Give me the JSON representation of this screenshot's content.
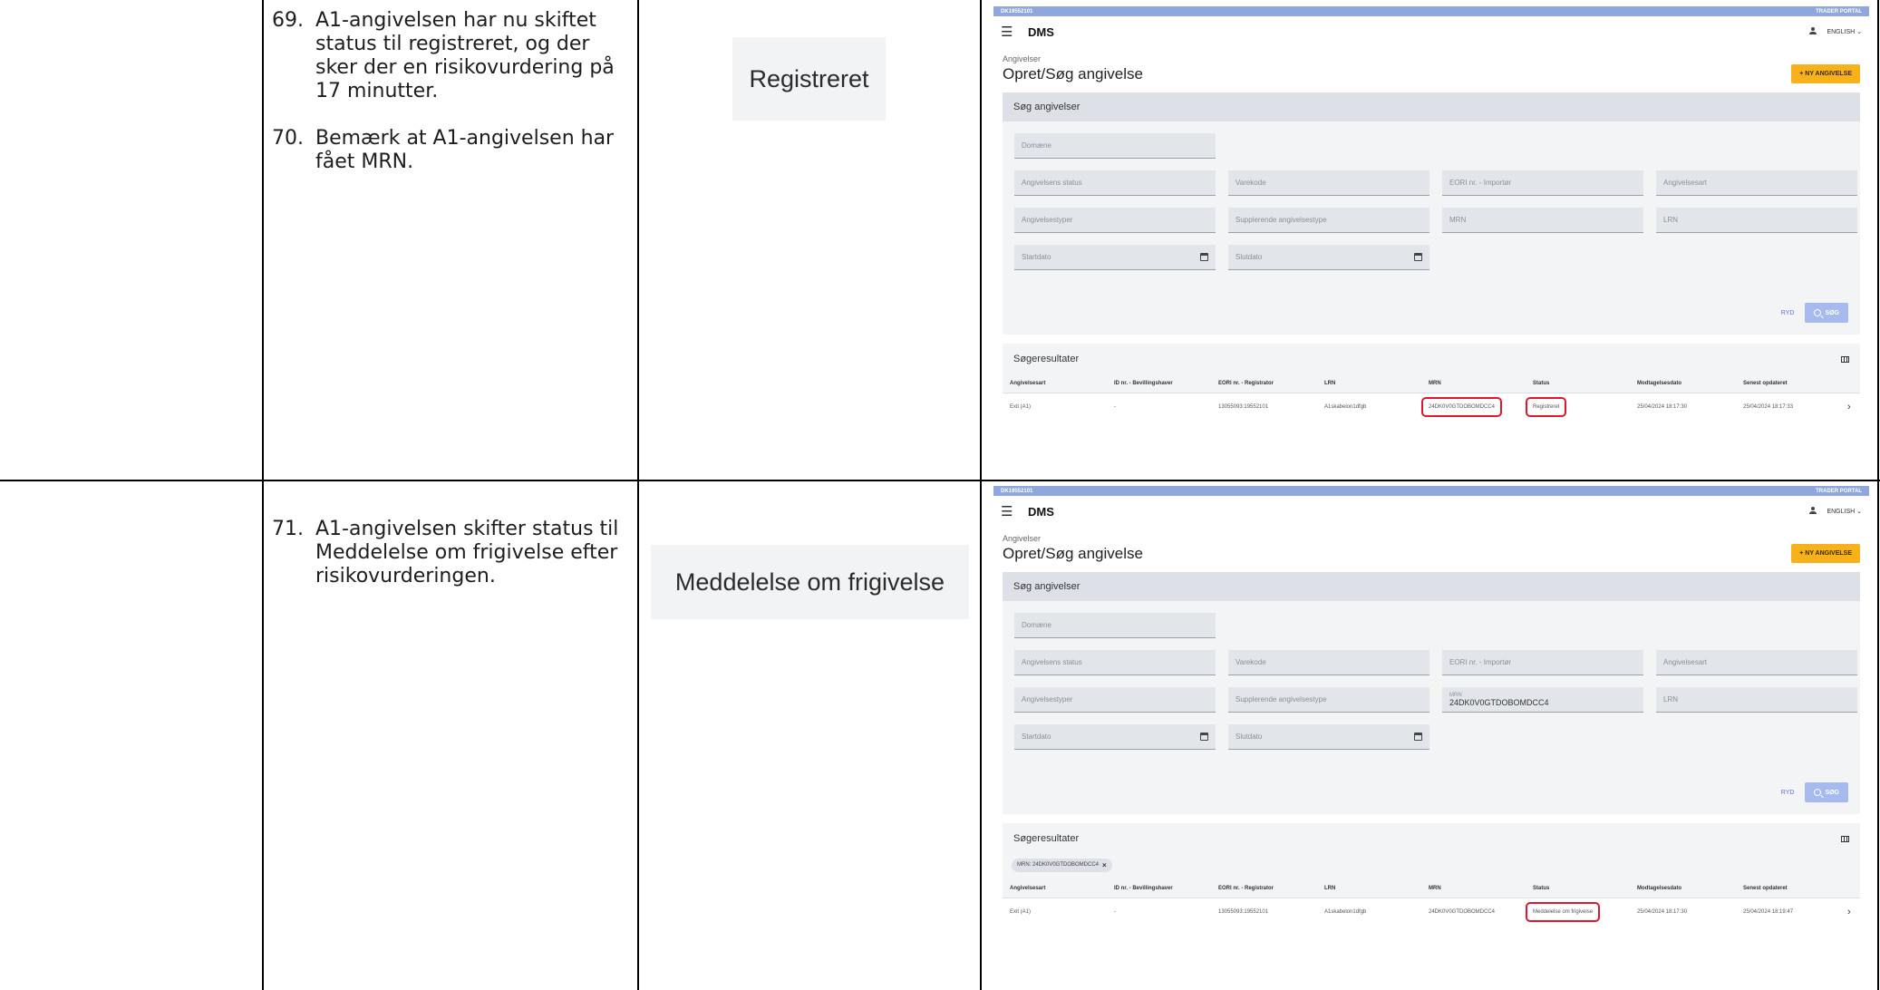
{
  "rows": [
    {
      "steps": [
        {
          "num": "69.",
          "text": "A1-angivelsen har nu skiftet status til registreret, og der sker der en risikovurdering på 17 minutter."
        },
        {
          "num": "70.",
          "text": "Bemærk at A1-angivelsen har fået MRN."
        }
      ],
      "status_crop": "Registreret",
      "screen": {
        "topbar_left": "DK19552101",
        "topbar_right": "TRADER PORTAL",
        "brand": "DMS",
        "language": "ENGLISH",
        "breadcrumb": "Angivelser",
        "page_title": "Opret/Søg angivelse",
        "new_button": "NY ANGIVELSE",
        "search_header": "Søg angivelser",
        "fields": {
          "domain": "Domæne",
          "status": "Angivelsens status",
          "commodity": "Varekode",
          "eori_importer": "EORI nr. - Importør",
          "decl_kind": "Angivelsesart",
          "decl_types": "Angivelsestyper",
          "supp_type": "Supplerende angivelsestype",
          "mrn_label": "MRN",
          "mrn_value": "",
          "lrn": "LRN",
          "start": "Startdato",
          "end": "Slutdato"
        },
        "clear": "RYD",
        "search": "SØG",
        "results_header": "Søgeresultater",
        "chip": "",
        "columns": [
          "Angivelsesart",
          "ID nr. - Bevillingshaver",
          "EORI nr. - Registrator",
          "LRN",
          "MRN",
          "Status",
          "Modtagelsesdato",
          "Senest opdateret"
        ],
        "row": [
          "Exit (A1)",
          "-",
          "13055093:19552101",
          "A1skabelon1dfgb",
          "24DK0V0GTDOBOMDCC4",
          "Registreret",
          "25/04/2024 18:17:30",
          "25/04/2024 18:17:33"
        ]
      }
    },
    {
      "steps": [
        {
          "num": "71.",
          "text": "A1-angivelsen skifter status til Meddelelse om frigivelse efter risikovurderingen."
        }
      ],
      "status_crop": "Meddelelse om frigivelse",
      "screen": {
        "topbar_left": "DK19552101",
        "topbar_right": "TRADER PORTAL",
        "brand": "DMS",
        "language": "ENGLISH",
        "breadcrumb": "Angivelser",
        "page_title": "Opret/Søg angivelse",
        "new_button": "NY ANGIVELSE",
        "search_header": "Søg angivelser",
        "fields": {
          "domain": "Domæne",
          "status": "Angivelsens status",
          "commodity": "Varekode",
          "eori_importer": "EORI nr. - Importør",
          "decl_kind": "Angivelsesart",
          "decl_types": "Angivelsestyper",
          "supp_type": "Supplerende angivelsestype",
          "mrn_label": "MRN",
          "mrn_value": "24DK0V0GTDOBOMDCC4",
          "lrn": "LRN",
          "start": "Startdato",
          "end": "Slutdato"
        },
        "clear": "RYD",
        "search": "SØG",
        "results_header": "Søgeresultater",
        "chip": "MRN: 24DK0V0GTDOBOMDCC4",
        "columns": [
          "Angivelsesart",
          "ID nr. - Bevillingshaver",
          "EORI nr. - Registrator",
          "LRN",
          "MRN",
          "Status",
          "Modtagelsesdato",
          "Senest opdateret"
        ],
        "row": [
          "Exit (A1)",
          "-",
          "13055093:19552101",
          "A1skabelon1dfgb",
          "24DK0V0GTDOBOMDCC4",
          "Meddelelse om frigivelse",
          "25/04/2024 18:17:30",
          "25/04/2024 18:19:47"
        ]
      }
    }
  ]
}
